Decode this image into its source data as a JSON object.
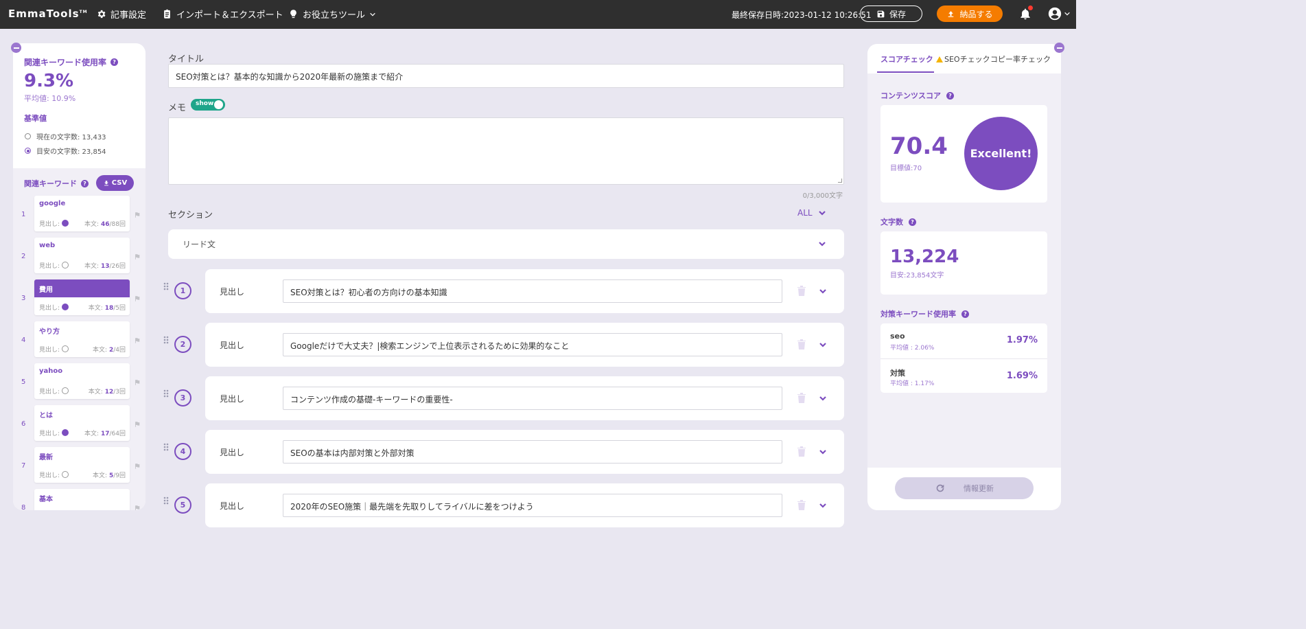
{
  "app": {
    "logo": "EmmaTools",
    "nav": {
      "article_settings": "記事設定",
      "import_export": "インポート＆エクスポート",
      "tools": "お役立ちツール"
    },
    "last_saved": "最終保存日時:2023-01-12 10:26:51",
    "save_label": "保存",
    "deliver_label": "納品する"
  },
  "left": {
    "usage_title": "関連キーワード使用率",
    "usage_rate": "9.3%",
    "usage_avg": "平均値: 10.9%",
    "base_label": "基準値",
    "option_current": "現在の文字数: 13,433",
    "option_target": "目安の文字数: 23,854",
    "selected_option": "target",
    "keywords_title": "関連キーワード",
    "csv_label": "CSV",
    "keywords": [
      {
        "num": "1",
        "name": "google",
        "heading_label": "見出し:",
        "heading_check": true,
        "body_label": "本文:",
        "count": "46",
        "target": "/88回",
        "active": false
      },
      {
        "num": "2",
        "name": "web",
        "heading_label": "見出し:",
        "heading_check": false,
        "body_label": "本文:",
        "count": "13",
        "target": "/26回",
        "active": false
      },
      {
        "num": "3",
        "name": "費用",
        "heading_label": "見出し:",
        "heading_check": true,
        "body_label": "本文:",
        "count": "18",
        "target": "/5回",
        "active": true
      },
      {
        "num": "4",
        "name": "やり方",
        "heading_label": "見出し:",
        "heading_check": false,
        "body_label": "本文:",
        "count": "2",
        "target": "/4回",
        "active": false
      },
      {
        "num": "5",
        "name": "yahoo",
        "heading_label": "見出し:",
        "heading_check": false,
        "body_label": "本文:",
        "count": "12",
        "target": "/3回",
        "active": false
      },
      {
        "num": "6",
        "name": "とは",
        "heading_label": "見出し:",
        "heading_check": true,
        "body_label": "本文:",
        "count": "17",
        "target": "/64回",
        "active": false
      },
      {
        "num": "7",
        "name": "最新",
        "heading_label": "見出し:",
        "heading_check": false,
        "body_label": "本文:",
        "count": "5",
        "target": "/9回",
        "active": false
      },
      {
        "num": "8",
        "name": "基本",
        "heading_label": "",
        "heading_check": false,
        "body_label": "",
        "count": "",
        "target": "",
        "active": false
      }
    ]
  },
  "editor": {
    "title_label": "タイトル",
    "title_value": "SEO対策とは？基本的な知識から2020年最新の施策まで紹介",
    "memo_label": "メモ",
    "memo_toggle": "show",
    "memo_counter": "0/3,000文字",
    "section_label": "セクション",
    "all_label": "ALL",
    "lead_label": "リード文",
    "heading_label": "見出し",
    "headings": [
      {
        "num": "1",
        "value": "SEO対策とは？初心者の方向けの基本知識"
      },
      {
        "num": "2",
        "value": "Googleだけで大丈夫？|検索エンジンで上位表示されるために効果的なこと"
      },
      {
        "num": "3",
        "value": "コンテンツ作成の基礎-キーワードの重要性-"
      },
      {
        "num": "4",
        "value": "SEOの基本は内部対策と外部対策"
      },
      {
        "num": "5",
        "value": "2020年のSEO施策｜最先端を先取りしてライバルに差をつけよう"
      }
    ]
  },
  "right": {
    "tabs": {
      "score": "スコアチェック",
      "seo": "SEOチェック",
      "copy": "コピー率チェック"
    },
    "content_score_title": "コンテンツスコア",
    "score": "70.4",
    "score_target": "目標値:70",
    "grade": "Excellent!",
    "char_title": "文字数",
    "char_count": "13,224",
    "char_target": "目安:23,854文字",
    "target_kw_title": "対策キーワード使用率",
    "target_keywords": [
      {
        "name": "seo",
        "avg": "平均値 : 2.06%",
        "rate": "1.97%"
      },
      {
        "name": "対策",
        "avg": "平均値 : 1.17%",
        "rate": "1.69%"
      }
    ],
    "refresh_label": "情報更新"
  },
  "colors": {
    "accent": "#7c4dbf",
    "topbar": "#2f2f2f",
    "deliver": "#f57c00",
    "toggle": "#1fa58a",
    "background": "#e9e7f1"
  }
}
